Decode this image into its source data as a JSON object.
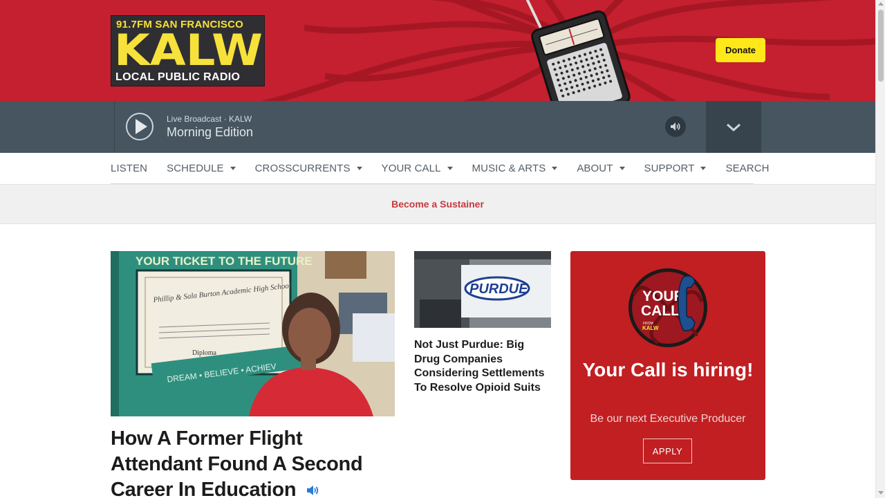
{
  "header": {
    "logo": {
      "frequency_text": "91.7FM SAN FRANCISCO",
      "call_letters": "KALW",
      "tagline": "LOCAL PUBLIC RADIO"
    },
    "donate_label": "Donate",
    "colors": {
      "banner": "#c4202f",
      "logo_yellow": "#f6e23a",
      "donate_yellow": "#ffe81a"
    }
  },
  "player": {
    "live_label": "Live Broadcast · KALW",
    "show_title": "Morning Edition",
    "icons": [
      "play-icon",
      "volume-icon",
      "chevron-down-icon"
    ]
  },
  "nav": {
    "items": [
      {
        "label": "LISTEN",
        "dropdown": false
      },
      {
        "label": "SCHEDULE",
        "dropdown": true
      },
      {
        "label": "CROSSCURRENTS",
        "dropdown": true
      },
      {
        "label": "YOUR CALL",
        "dropdown": true
      },
      {
        "label": "MUSIC & ARTS",
        "dropdown": true
      },
      {
        "label": "ABOUT",
        "dropdown": true
      },
      {
        "label": "SUPPORT",
        "dropdown": true
      },
      {
        "label": "SEARCH",
        "dropdown": false
      }
    ]
  },
  "sustainer": {
    "label": "Become a Sustainer",
    "color": "#c5393f"
  },
  "main_story": {
    "photo_sign_text": "YOUR TICKET TO THE FUTURE",
    "photo_banner_text": "DREAM • BELIEVE • ACHIEV",
    "headline": "How A Former Flight Attendant Found A Second Career In Education",
    "audio_icon": "speaker-icon"
  },
  "secondary_story": {
    "photo_sign_text": "PURDUE",
    "headline": "Not Just Purdue: Big Drug Companies Considering Settlements To Resolve Opioid Suits"
  },
  "promo": {
    "logo_line1": "YOUR",
    "logo_line2": "CALL",
    "logo_small": "FROM",
    "logo_station": "KALW",
    "title": "Your Call is hiring!",
    "subtitle": "Be our next Executive Producer",
    "button_label": "APPLY",
    "color": "#c11f22"
  }
}
